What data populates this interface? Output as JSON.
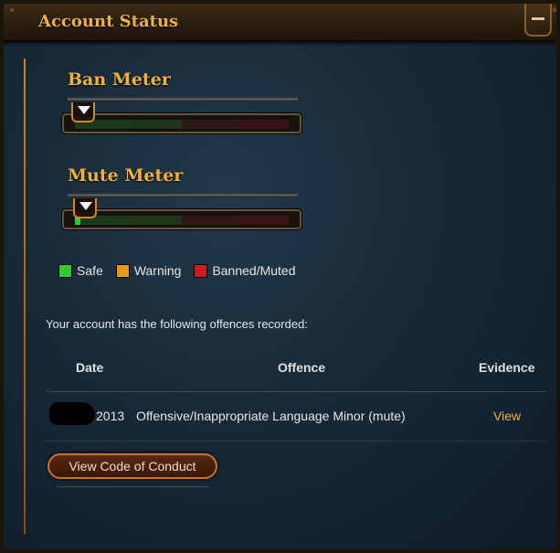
{
  "window": {
    "title": "Account Status",
    "minimize_icon": "minus-icon"
  },
  "meters": [
    {
      "title": "Ban Meter",
      "level": 0.0
    },
    {
      "title": "Mute Meter",
      "level": 0.03
    }
  ],
  "legend": [
    {
      "label": "Safe",
      "color": "#2fcc2f"
    },
    {
      "label": "Warning",
      "color": "#e39a18"
    },
    {
      "label": "Banned/Muted",
      "color": "#cc1d1d"
    }
  ],
  "offences": {
    "intro": "Your account has the following offences recorded:",
    "columns": {
      "date": "Date",
      "offence": "Offence",
      "evidence": "Evidence"
    },
    "rows": [
      {
        "date": "2013",
        "offence": "Offensive/Inappropriate Language Minor (mute)",
        "evidence": "View"
      }
    ]
  },
  "buttons": {
    "code_of_conduct": "View Code of Conduct"
  },
  "colors": {
    "accent": "#f0b13c",
    "panel": "#172938"
  }
}
